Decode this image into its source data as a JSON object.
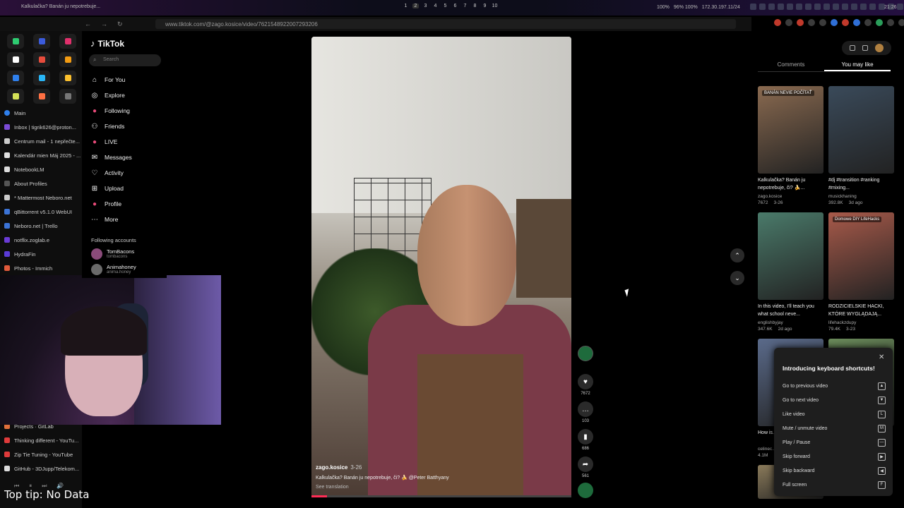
{
  "system_bar": {
    "window_title": "Kalkulačka? Banán ju nepotrebuje...",
    "workspaces": [
      "1",
      "2",
      "3",
      "4",
      "5",
      "6",
      "7",
      "8",
      "9",
      "10"
    ],
    "stats": [
      "100%",
      "96% 100%",
      "172.30.197.11/24"
    ],
    "clock": "21:26"
  },
  "browser": {
    "url": "www.tiktok.com/@zago.kosice/video/7621548922007293206"
  },
  "left_panel": {
    "tabs_group": "Main",
    "tabs": [
      {
        "label": "Inbox | tigrik626@proton...",
        "color": "#7b4bd6"
      },
      {
        "label": "Centrum mail - 1 nepřečte...",
        "color": "#cccccc"
      },
      {
        "label": "Kalendár mien Máj 2025 - ...",
        "color": "#e0e0e0"
      },
      {
        "label": "NotebookLM",
        "color": "#dddddd"
      },
      {
        "label": "About Profiles",
        "color": "#555555"
      },
      {
        "label": "* Mattermost Neboro.net",
        "color": "#cccccc"
      },
      {
        "label": "qBittorrent v5.1.0 WebUI",
        "color": "#3b73d6"
      },
      {
        "label": "Neboro.net | Trello",
        "color": "#3b73d6"
      },
      {
        "label": "notflix.zoglab.e",
        "color": "#6a3bd6"
      },
      {
        "label": "HydraFin",
        "color": "#5a3bd6"
      },
      {
        "label": "Photos - Immich",
        "color": "#e05a3b"
      }
    ],
    "tabs_bottom": [
      {
        "label": "Projects · GitLab",
        "color": "#e0703b"
      },
      {
        "label": "Thinking different - YouTu...",
        "color": "#e03b3b"
      },
      {
        "label": "Zip Tie Tuning - YouTube",
        "color": "#e03b3b"
      },
      {
        "label": "GitHub - 3DJupp/Telekom...",
        "color": "#dddddd"
      }
    ],
    "top_tip": "Top tip: No Data"
  },
  "tiktok": {
    "logo": "TikTok",
    "search_placeholder": "Search",
    "menu": [
      {
        "label": "For You",
        "icon": "home-icon"
      },
      {
        "label": "Explore",
        "icon": "compass-icon"
      },
      {
        "label": "Following",
        "icon": "following-icon"
      },
      {
        "label": "Friends",
        "icon": "friends-icon"
      },
      {
        "label": "LIVE",
        "icon": "live-icon"
      },
      {
        "label": "Messages",
        "icon": "messages-icon"
      },
      {
        "label": "Activity",
        "icon": "activity-icon"
      },
      {
        "label": "Upload",
        "icon": "upload-icon"
      },
      {
        "label": "Profile",
        "icon": "profile-icon"
      },
      {
        "label": "More",
        "icon": "more-icon"
      }
    ],
    "following_accounts_title": "Following accounts",
    "accounts": [
      {
        "name": "TomBacons",
        "handle": "tombacons"
      },
      {
        "name": "Animahoney",
        "handle": "anima.honey"
      }
    ]
  },
  "video": {
    "author": "zago.kosice",
    "date": "3-26",
    "description": "Kalkulačka? Banán ju nepotrebuje, či? 🍌 @Peter Batthyany",
    "see_translation": "See translation",
    "likes": "7672",
    "comments": "103",
    "saves": "686",
    "shares": "561",
    "progress": 0.06
  },
  "right_panel": {
    "tabs": [
      "Comments",
      "You may like"
    ],
    "active_tab": "You may like",
    "cards": [
      {
        "label": "BANÁN NEVIE POČÍTAŤ",
        "title": "Kalkulačka? Banán ju nepotrebuje, či? 🍌...",
        "user": "zago.kosice",
        "likes": "7672",
        "date": "3-26",
        "color": "#8a6a50"
      },
      {
        "label": "",
        "title": "#dj #transition #ranking #mixing...",
        "user": "musickhaning",
        "likes": "392.8K",
        "date": "3d ago",
        "color": "#3a4a5a"
      },
      {
        "label": "",
        "title": "In this video, I'll teach you what school neve...",
        "user": "englishbyjay",
        "likes": "347.6K",
        "date": "2d ago",
        "color": "#4a7a6a"
      },
      {
        "label": "Domowe DIY LifeHacks",
        "title": "RODZICIELSKIE HACKI, KTÓRE WYGLĄDAJĄ...",
        "user": "lifehackzdupy",
        "likes": "79.4K",
        "date": "3-23",
        "color": "#a85a4a"
      },
      {
        "label": "",
        "title": "How is...",
        "user": "celinec...",
        "likes": "4.1M",
        "date": "",
        "color": "#5a6a8a"
      },
      {
        "label": "",
        "title": "",
        "user": "",
        "likes": "",
        "date": "",
        "color": "#6a8a5a"
      },
      {
        "label": "",
        "title": "",
        "user": "",
        "likes": "",
        "date": "",
        "color": "#8a7a5a"
      }
    ],
    "shortcuts_popup": {
      "title": "Introducing keyboard shortcuts!",
      "items": [
        {
          "label": "Go to previous video",
          "key": "▲"
        },
        {
          "label": "Go to next video",
          "key": "▼"
        },
        {
          "label": "Like video",
          "key": "L"
        },
        {
          "label": "Mute / unmute video",
          "key": "M"
        },
        {
          "label": "Play / Pause",
          "key": "—"
        },
        {
          "label": "Skip forward",
          "key": "▶"
        },
        {
          "label": "Skip backward",
          "key": "◀"
        },
        {
          "label": "Full screen",
          "key": "F"
        }
      ]
    }
  }
}
